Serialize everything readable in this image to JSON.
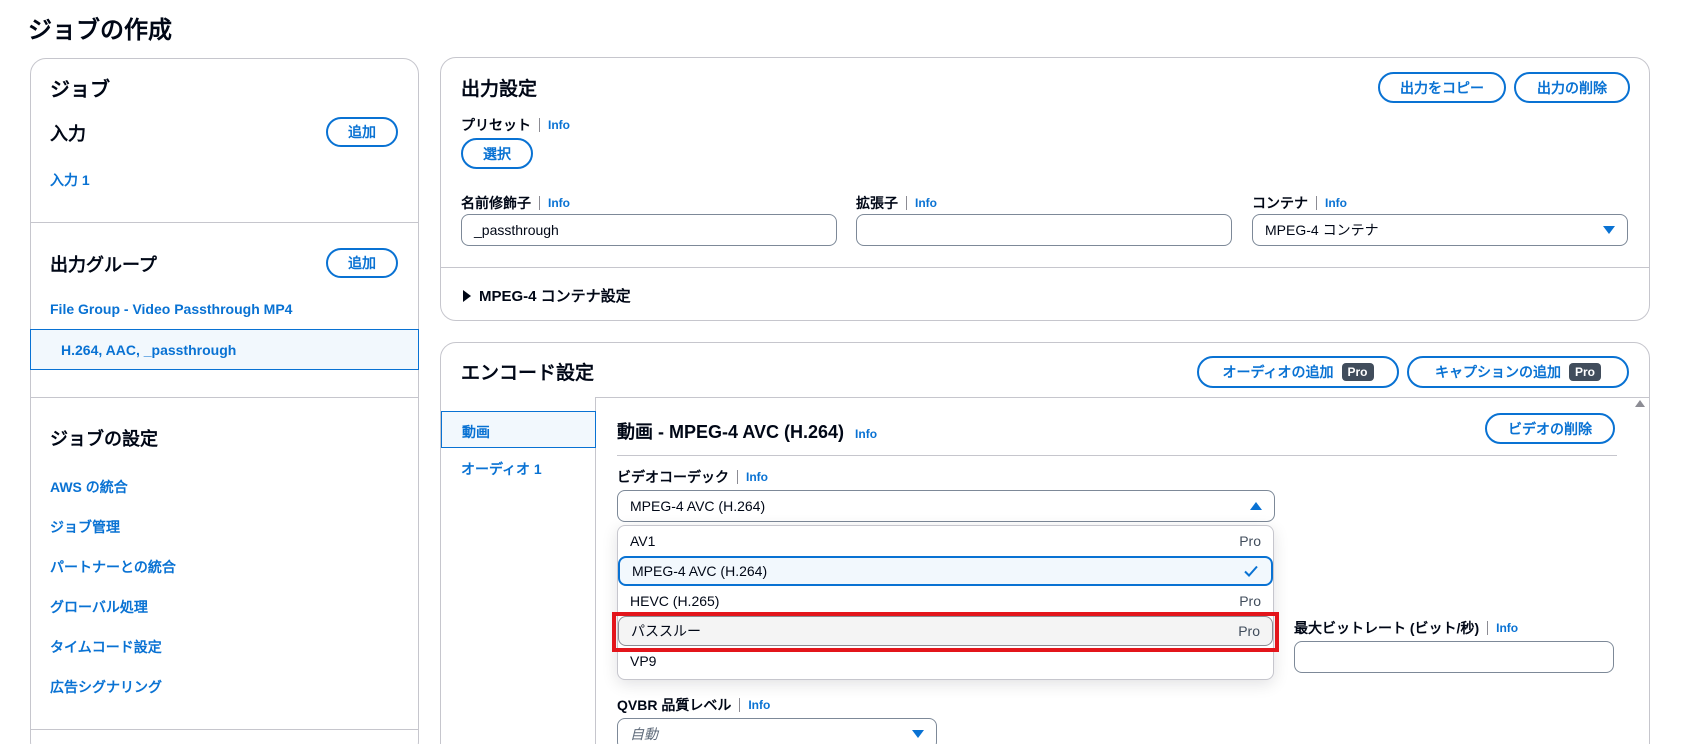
{
  "page": {
    "title": "ジョブの作成"
  },
  "left": {
    "job_heading": "ジョブ",
    "input_heading": "入力",
    "add_label": "追加",
    "input_item": "入力 1",
    "output_group_heading": "出力グループ",
    "output_group_item": "File Group - Video Passthrough MP4",
    "output_item": "H.264, AAC, _passthrough",
    "job_settings_heading": "ジョブの設定",
    "settings_items": [
      "AWS の統合",
      "ジョブ管理",
      "パートナーとの統合",
      "グローバル処理",
      "タイムコード設定",
      "広告シグナリング"
    ]
  },
  "output": {
    "heading": "出力設定",
    "copy_button": "出力をコピー",
    "delete_button": "出力の削除",
    "preset_label": "プリセット",
    "info": "Info",
    "select_button": "選択",
    "name_modifier_label": "名前修飾子",
    "name_modifier_value": "_passthrough",
    "extension_label": "拡張子",
    "extension_value": "",
    "container_label": "コンテナ",
    "container_value": "MPEG-4 コンテナ",
    "container_settings": "MPEG-4 コンテナ設定"
  },
  "encode": {
    "heading": "エンコード設定",
    "add_audio_button": "オーディオの追加",
    "add_caption_button": "キャプションの追加",
    "pro_badge": "Pro",
    "tabs": [
      "動画",
      "オーディオ 1"
    ],
    "video_heading": "動画 - MPEG-4 AVC (H.264)",
    "delete_video_button": "ビデオの削除",
    "codec_label": "ビデオコーデック",
    "codec_value": "MPEG-4 AVC (H.264)",
    "codec_options": [
      {
        "label": "AV1",
        "tag": "Pro"
      },
      {
        "label": "MPEG-4 AVC (H.264)",
        "tag": ""
      },
      {
        "label": "HEVC (H.265)",
        "tag": "Pro"
      },
      {
        "label": "パススルー",
        "tag": "Pro"
      },
      {
        "label": "VP9",
        "tag": ""
      }
    ],
    "max_bitrate_label": "最大ビットレート (ビット/秒)",
    "max_bitrate_value": "",
    "qvbr_label": "QVBR 品質レベル",
    "qvbr_placeholder": "自動"
  },
  "colors": {
    "accent": "#0972d3",
    "highlight": "#e3151b",
    "border": "#c6c6cd"
  }
}
